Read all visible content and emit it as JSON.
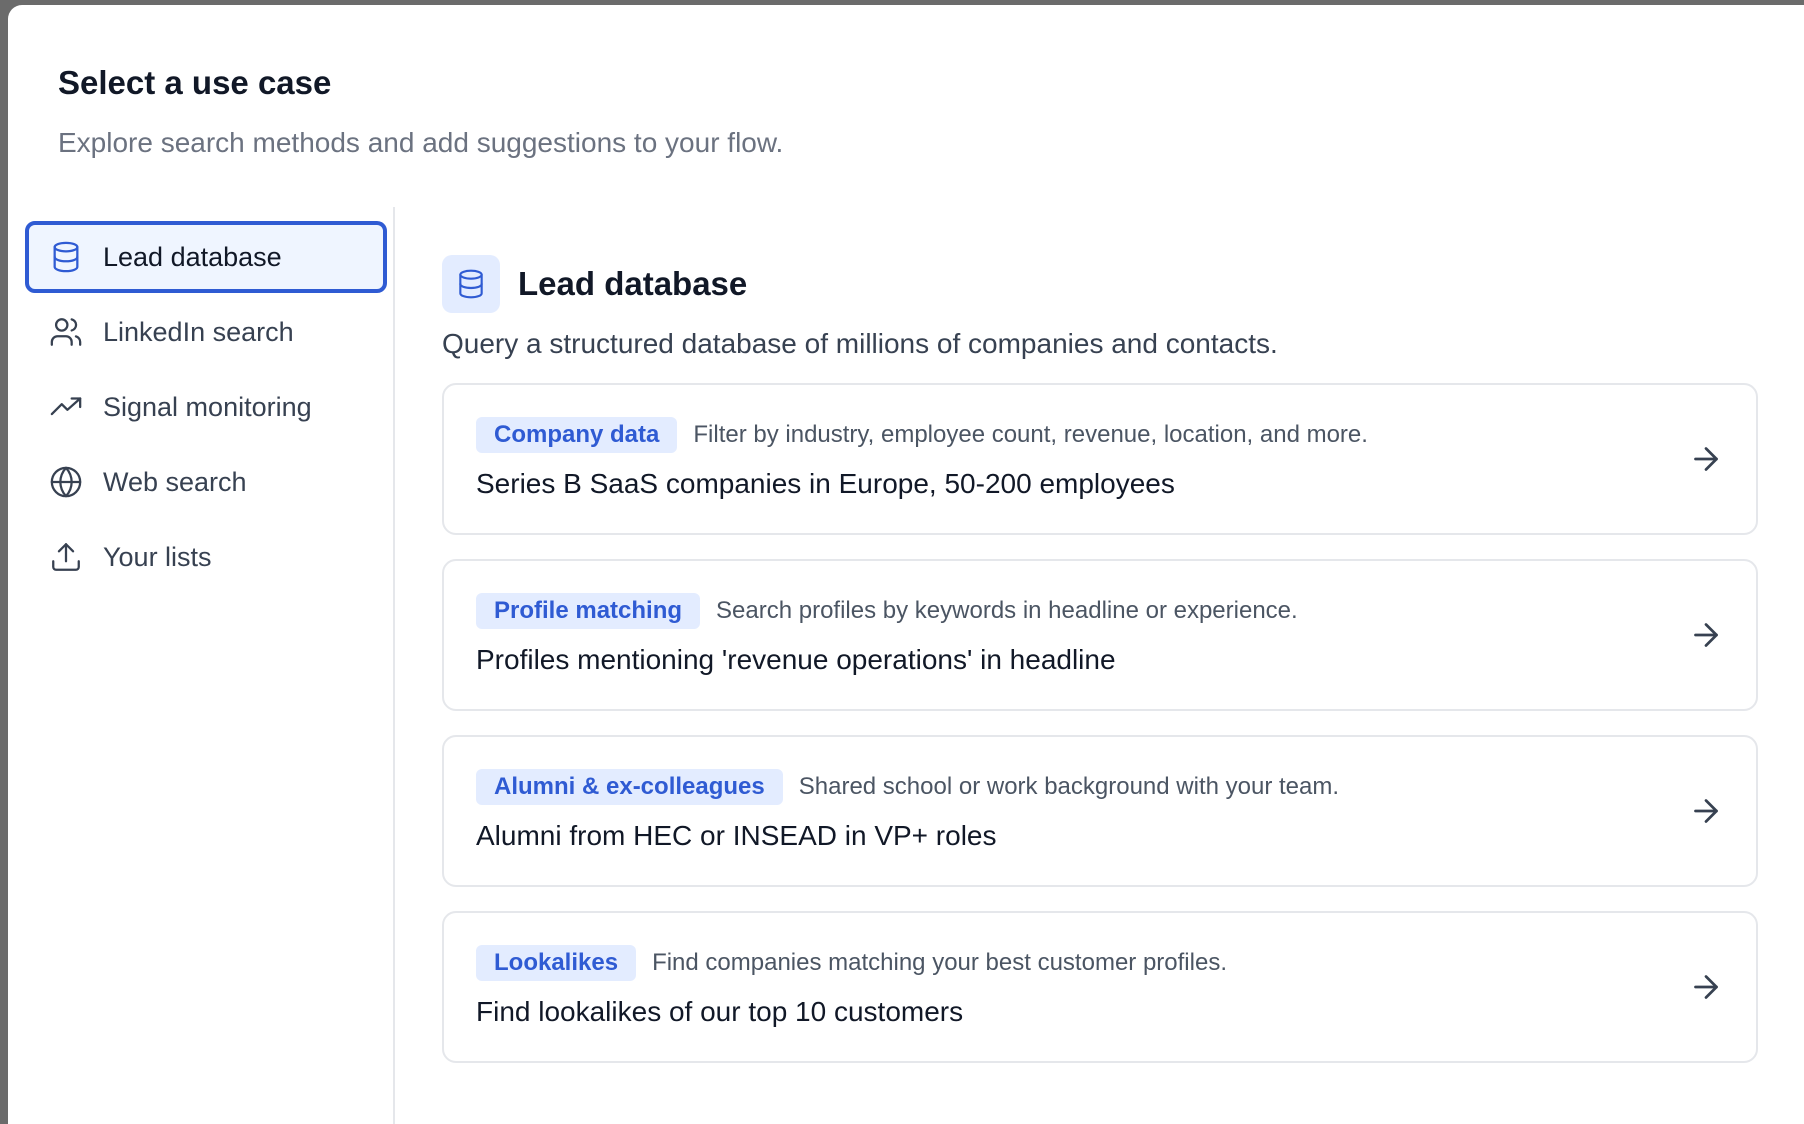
{
  "header": {
    "title": "Select a use case",
    "subtitle": "Explore search methods and add suggestions to your flow."
  },
  "sidebar": {
    "items": [
      {
        "label": "Lead database",
        "icon": "database-icon",
        "active": true
      },
      {
        "label": "LinkedIn search",
        "icon": "users-icon",
        "active": false
      },
      {
        "label": "Signal monitoring",
        "icon": "trending-up-icon",
        "active": false
      },
      {
        "label": "Web search",
        "icon": "globe-icon",
        "active": false
      },
      {
        "label": "Your lists",
        "icon": "upload-icon",
        "active": false
      }
    ]
  },
  "main": {
    "title": "Lead database",
    "icon": "database-icon",
    "description": "Query a structured database of millions of companies and contacts.",
    "cards": [
      {
        "badge": "Company data",
        "description": "Filter by industry, employee count, revenue, location, and more.",
        "query": "Series B SaaS companies in Europe, 50-200 employees"
      },
      {
        "badge": "Profile matching",
        "description": "Search profiles by keywords in headline or experience.",
        "query": "Profiles mentioning 'revenue operations' in headline"
      },
      {
        "badge": "Alumni & ex-colleagues",
        "description": "Shared school or work background with your team.",
        "query": "Alumni from HEC or INSEAD in VP+ roles"
      },
      {
        "badge": "Lookalikes",
        "description": "Find companies matching your best customer profiles.",
        "query": "Find lookalikes of our top 10 customers"
      }
    ]
  },
  "colors": {
    "accent": "#2f5bd3",
    "accent_light": "#e3ecff",
    "active_bg": "#eff5ff",
    "border": "#e5e7eb",
    "text_primary": "#111827",
    "text_muted": "#6b7280"
  }
}
